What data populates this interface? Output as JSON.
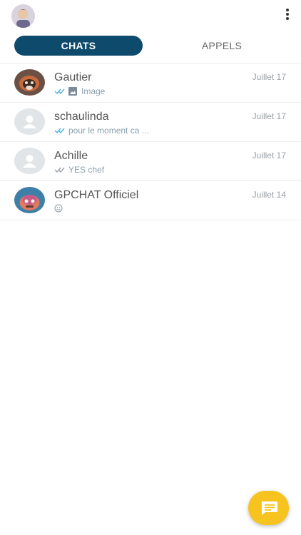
{
  "tabs": [
    {
      "label": "CHATS",
      "active": true
    },
    {
      "label": "APPELS",
      "active": false
    }
  ],
  "chats": [
    {
      "name": "Gautier",
      "date": "Juillet 17",
      "preview": "Image",
      "status": "read",
      "avatar": "raccoon-photo"
    },
    {
      "name": "schaulinda",
      "date": "Juillet 17",
      "preview": "pour le moment ca ...",
      "status": "read",
      "avatar": "default-user"
    },
    {
      "name": "Achille",
      "date": "Juillet 17",
      "preview": "YES chef",
      "status": "delivered",
      "avatar": "default-user"
    },
    {
      "name": "GPCHAT Officiel",
      "date": "Juillet 14",
      "preview": "",
      "status": "emoji",
      "avatar": "robot-photo"
    }
  ],
  "colors": {
    "tab_active": "#0d4a6b",
    "fab": "#f7c31f",
    "tick_read": "#4ab0e0",
    "tick_delivered": "#9aa0a6"
  },
  "icons": {
    "menu": "more-vert-icon",
    "fab": "chat-icon"
  }
}
